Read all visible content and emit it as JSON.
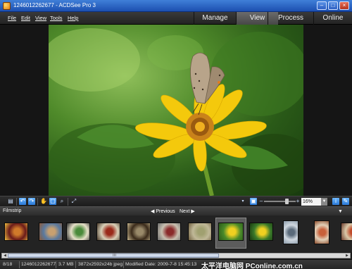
{
  "window": {
    "title": "1246012262677 - ACDSee Pro 3",
    "minimize": "–",
    "maximize": "□",
    "close": "×"
  },
  "menu": [
    "File",
    "Edit",
    "View",
    "Tools",
    "Help"
  ],
  "modes": [
    {
      "label": "Manage",
      "active": false
    },
    {
      "label": "View",
      "active": true
    },
    {
      "label": "Process",
      "active": false
    },
    {
      "label": "Online",
      "active": false
    }
  ],
  "viewer": {
    "image_subject": "butterfly on yellow flower",
    "zoom": "16%"
  },
  "toolbar_icons": [
    "filmstrip-toggle-icon",
    "rotate-left-icon",
    "rotate-right-icon",
    "hand-tool-icon",
    "select-tool-icon",
    "zoom-tool-icon",
    "fullscreen-arrows-icon",
    "zoom-out-icon",
    "zoom-in-icon",
    "info-icon",
    "properties-icon"
  ],
  "filmstrip": {
    "title": "Filmstrip",
    "prev": "◀ Previous",
    "next": "Next ▶",
    "thumbnails": [
      {
        "colors": [
          "#6a1a1a",
          "#d07a2a",
          "#f0c040"
        ]
      },
      {
        "colors": [
          "#5a7aa0",
          "#c8a070",
          "#8a5a3a"
        ]
      },
      {
        "colors": [
          "#e6e0c8",
          "#4a8a3a",
          "#2a2a2a"
        ]
      },
      {
        "colors": [
          "#d8d0b8",
          "#9a2a1a",
          "#4a3a2a"
        ]
      },
      {
        "colors": [
          "#3a2a1a",
          "#9a8a6a",
          "#c8b890"
        ]
      },
      {
        "colors": [
          "#c8c0b0",
          "#8a2a2a",
          "#6a6a6a"
        ]
      },
      {
        "colors": [
          "#c0b898",
          "#a0a070",
          "#706040"
        ]
      },
      {
        "colors": [
          "#4a8a2a",
          "#f0d020",
          "#2a5a18"
        ],
        "selected": true
      },
      {
        "colors": [
          "#3a7a2a",
          "#f0d020",
          "#1a3a10"
        ]
      },
      {
        "colors": [
          "#d0d8e0",
          "#5a6a7a",
          "#8a9aa8"
        ],
        "portrait": true
      },
      {
        "colors": [
          "#e0d0b8",
          "#c8603a",
          "#8a4a2a"
        ],
        "portrait": true
      },
      {
        "colors": [
          "#d8c8a8",
          "#c04a2a",
          "#6a3a2a"
        ]
      }
    ]
  },
  "status": {
    "index": "8/18",
    "filename": "1246012262677",
    "size": "3.7 MB",
    "format": "3872x2592x24b jpeg",
    "modified": "Modified Date: 2009-7-8 15:45:13",
    "watermark": "太平洋电脑网 PConline.com.cn"
  }
}
